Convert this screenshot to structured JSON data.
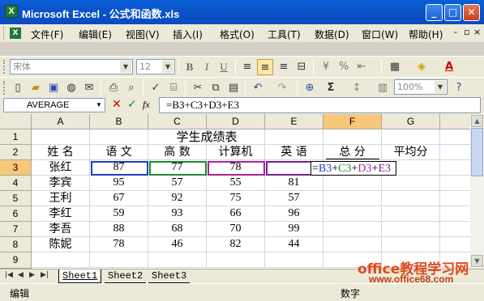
{
  "window": {
    "app_icon": "X",
    "title": "Microsoft Excel - 公式和函数.xls",
    "min_label": "_",
    "max_label": "□",
    "close_label": "✕"
  },
  "menu": {
    "items": [
      "文件(F)",
      "编辑(E)",
      "视图(V)",
      "插入(I)",
      "格式(O)",
      "工具(T)",
      "数据(D)",
      "窗口(W)",
      "帮助(H)"
    ],
    "mdi_min": "-",
    "mdi_restore": "▫",
    "mdi_close": "×"
  },
  "format_toolbar": {
    "font_name": "宋体",
    "font_size": "12",
    "bold": "B",
    "italic": "I",
    "underline": "U",
    "font_color": "A",
    "currency": "¥"
  },
  "standard_toolbar": {
    "zoom": "100%",
    "sum": "Σ"
  },
  "formula_bar": {
    "name_box": "AVERAGE",
    "cancel": "✕",
    "enter": "✓",
    "fx": "fx",
    "formula": "=B3+C3+D3+E3"
  },
  "grid": {
    "columns": [
      "A",
      "B",
      "C",
      "D",
      "E",
      "F",
      "G"
    ],
    "rows": [
      "1",
      "2",
      "3",
      "4",
      "5",
      "6",
      "7",
      "8",
      "9"
    ],
    "title": "学生成绩表",
    "headers": [
      "姓 名",
      "语 文",
      "高 数",
      "计算机",
      "英 语",
      "总 分",
      "平均分"
    ],
    "data": [
      [
        "张红",
        "87",
        "77",
        "78",
        ""
      ],
      [
        "李宾",
        "95",
        "57",
        "55",
        "81"
      ],
      [
        "王利",
        "67",
        "92",
        "75",
        "57"
      ],
      [
        "李红",
        "59",
        "93",
        "66",
        "96"
      ],
      [
        "李吾",
        "88",
        "68",
        "70",
        "99"
      ],
      [
        "陈妮",
        "78",
        "46",
        "82",
        "44"
      ]
    ],
    "edit_eq": "=",
    "edit_parts": [
      "B3",
      "+",
      "C3",
      "+",
      "D3",
      "+",
      "E3"
    ],
    "ref_colors": [
      "#1f3fbf",
      "#1e8a2e",
      "#b0209a",
      "#7a2090"
    ]
  },
  "sheets": [
    "Sheet1",
    "Sheet2",
    "Sheet3"
  ],
  "status": {
    "mode": "编辑",
    "numlock": "数字"
  },
  "watermark": {
    "line1": "office教程学习网",
    "line2": "www.office68.com"
  }
}
